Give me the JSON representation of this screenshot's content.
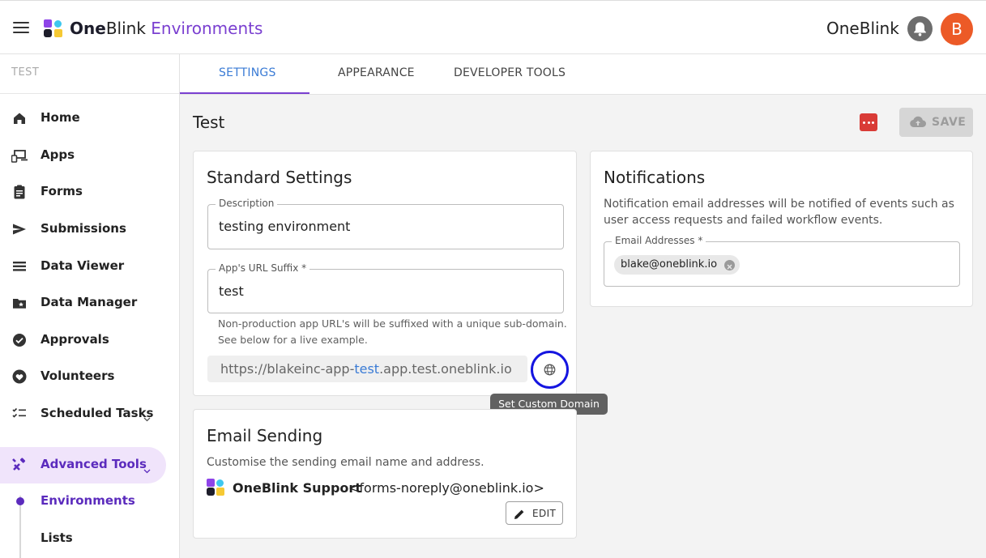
{
  "header": {
    "brand_bold": "One",
    "brand_regular": "Blink",
    "brand_env": "Environments",
    "org_name": "OneBlink",
    "avatar_letter": "B"
  },
  "sidebar": {
    "environment_label": "TEST",
    "items": [
      {
        "label": "Home",
        "icon": "home-icon"
      },
      {
        "label": "Apps",
        "icon": "devices-icon"
      },
      {
        "label": "Forms",
        "icon": "clipboard-icon"
      },
      {
        "label": "Submissions",
        "icon": "send-icon"
      },
      {
        "label": "Data Viewer",
        "icon": "list-icon"
      },
      {
        "label": "Data Manager",
        "icon": "folder-star-icon"
      },
      {
        "label": "Approvals",
        "icon": "check-circle-icon"
      },
      {
        "label": "Volunteers",
        "icon": "volunteer-heart-icon"
      },
      {
        "label": "Scheduled Tasks",
        "icon": "checklist-icon"
      },
      {
        "label": "Advanced Tools",
        "icon": "tools-icon"
      }
    ],
    "sub_items": [
      {
        "label": "Environments"
      },
      {
        "label": "Lists"
      }
    ]
  },
  "tabs": [
    {
      "label": "SETTINGS",
      "active": true
    },
    {
      "label": "APPEARANCE",
      "active": false
    },
    {
      "label": "DEVELOPER TOOLS",
      "active": false
    }
  ],
  "page": {
    "title": "Test",
    "save_label": "SAVE"
  },
  "standard_settings": {
    "title": "Standard Settings",
    "description_label": "Description",
    "description_value": "testing environment",
    "url_suffix_label": "App's URL Suffix *",
    "url_suffix_value": "test",
    "helper_line1": "Non-production app URL's will be suffixed with a unique sub-domain.",
    "helper_line2": "See below for a live example.",
    "url_prefix": "https://blakeinc-app-",
    "url_highlight": "test",
    "url_suffix": ".app.test.oneblink.io",
    "tooltip": "Set Custom Domain"
  },
  "notifications": {
    "title": "Notifications",
    "description": "Notification email addresses will be notified of events such as user access requests and failed workflow events.",
    "email_label": "Email Addresses *",
    "emails": [
      "blake@oneblink.io"
    ]
  },
  "email_sending": {
    "title": "Email Sending",
    "description": "Customise the sending email name and address.",
    "sender_name": "OneBlink Support",
    "sender_address": "<forms-noreply@oneblink.io>",
    "edit_label": "EDIT"
  },
  "colors": {
    "accent_purple": "#7a3fd0",
    "link_blue": "#3a7bd5",
    "avatar_orange": "#ec5a27",
    "danger_red": "#d93b36"
  }
}
